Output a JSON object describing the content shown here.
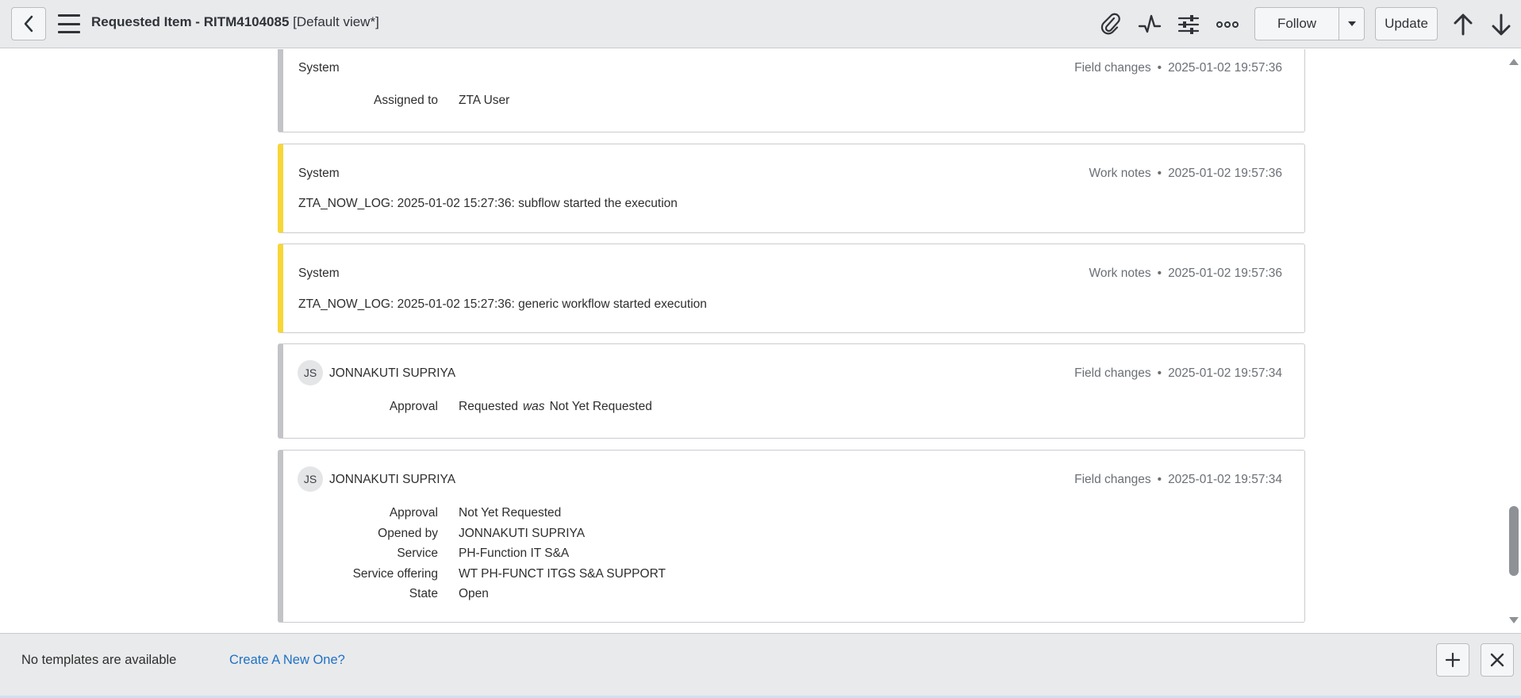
{
  "header": {
    "title_main": "Requested Item - RITM4104085",
    "title_view": " [Default view*]",
    "follow_label": "Follow",
    "update_label": "Update"
  },
  "activity": [
    {
      "author": "System",
      "type": "Field changes",
      "timestamp": "2025-01-02 19:57:36",
      "fields": [
        {
          "label": "Assigned to",
          "value": "ZTA User"
        }
      ]
    },
    {
      "author": "System",
      "type": "Work notes",
      "timestamp": "2025-01-02 19:57:36",
      "text": "ZTA_NOW_LOG: 2025-01-02 15:27:36: subflow started the execution"
    },
    {
      "author": "System",
      "type": "Work notes",
      "timestamp": "2025-01-02 19:57:36",
      "text": "ZTA_NOW_LOG: 2025-01-02 15:27:36: generic workflow started execution"
    },
    {
      "author": "JONNAKUTI SUPRIYA",
      "initials": "JS",
      "type": "Field changes",
      "timestamp": "2025-01-02 19:57:34",
      "fields": [
        {
          "label": "Approval",
          "value": "Requested",
          "was_label": "was",
          "old_value": "Not Yet Requested"
        }
      ]
    },
    {
      "author": "JONNAKUTI SUPRIYA",
      "initials": "JS",
      "type": "Field changes",
      "timestamp": "2025-01-02 19:57:34",
      "fields": [
        {
          "label": "Approval",
          "value": "Not Yet Requested"
        },
        {
          "label": "Opened by",
          "value": "JONNAKUTI SUPRIYA"
        },
        {
          "label": "Service",
          "value": "PH-Function IT S&A"
        },
        {
          "label": "Service offering",
          "value": "WT PH-FUNCT ITGS S&A SUPPORT"
        },
        {
          "label": "State",
          "value": "Open"
        }
      ]
    }
  ],
  "templates": {
    "message": "No templates are available",
    "create_link": "Create A New One?"
  },
  "colors": {
    "header_bg": "#e9eaec",
    "work_notes_accent": "#f7d637",
    "field_changes_accent": "#c2c4c7",
    "link": "#1f72c4"
  },
  "icons": {
    "back": "chevron-left-icon",
    "menu": "hamburger-menu-icon",
    "attach": "paperclip-icon",
    "activity": "activity-pulse-icon",
    "personalize": "sliders-icon",
    "more": "more-options-icon",
    "follow_menu": "caret-down-icon",
    "previous": "arrow-up-icon",
    "next": "arrow-down-icon",
    "add": "plus-icon",
    "close": "close-icon"
  }
}
